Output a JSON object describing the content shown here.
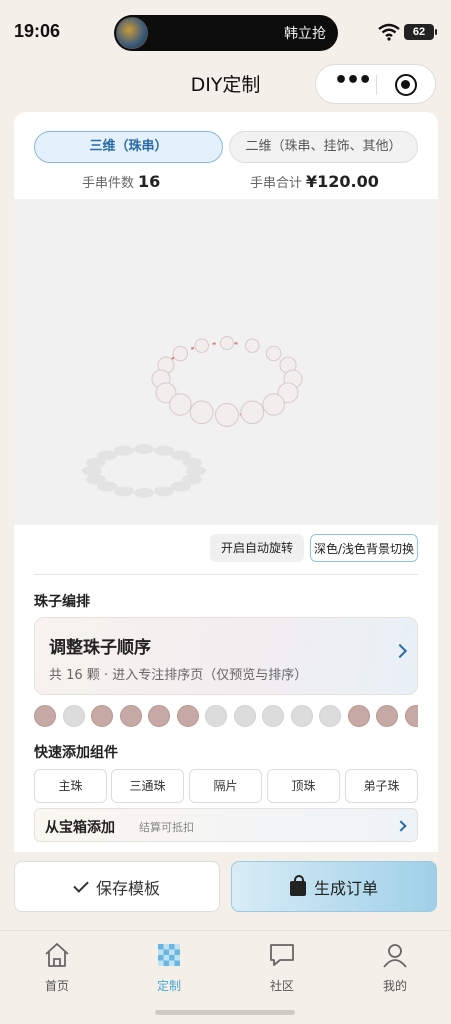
{
  "status_bar": {
    "time": "19:06",
    "notification_text": "韩立抢",
    "battery": "62"
  },
  "nav": {
    "title": "DIY定制"
  },
  "mode_tabs": [
    {
      "label": "三维（珠串）",
      "active": true
    },
    {
      "label": "二维（珠串、挂饰、其他）",
      "active": false
    }
  ],
  "stats": {
    "count_label": "手串件数",
    "count_value": "16",
    "total_label": "手串合计",
    "total_value": "¥120.00"
  },
  "viewer_controls": {
    "rotate_label": "开启自动旋转",
    "bg_toggle_label": "深色/浅色背景切换"
  },
  "arrangement": {
    "title": "珠子编排",
    "order_card_title": "调整珠子顺序",
    "order_card_sub": "共 16 颗 · 进入专注排序页（仅预览与排序）"
  },
  "bead_colors": [
    "pink",
    "white",
    "pink",
    "pink",
    "pink",
    "pink",
    "white",
    "white",
    "white",
    "white",
    "white",
    "pink",
    "pink",
    "pink"
  ],
  "colors": {
    "pink_bead": "#c6a8a5",
    "white_bead": "#dcdcdc",
    "accent": "#4aa6d6",
    "string": "#e07878"
  },
  "quick_add": {
    "title": "快速添加组件",
    "chips": [
      "主珠",
      "三通珠",
      "隔片",
      "顶珠",
      "弟子珠"
    ]
  },
  "treasure": {
    "title": "从宝箱添加",
    "sub": "结算可抵扣"
  },
  "actions": {
    "save_label": "保存模板",
    "order_label": "生成订单"
  },
  "tabbar": [
    {
      "label": "首页",
      "icon": "home-icon",
      "active": false
    },
    {
      "label": "定制",
      "icon": "customize-icon",
      "active": true
    },
    {
      "label": "社区",
      "icon": "chat-icon",
      "active": false
    },
    {
      "label": "我的",
      "icon": "user-icon",
      "active": false
    }
  ]
}
